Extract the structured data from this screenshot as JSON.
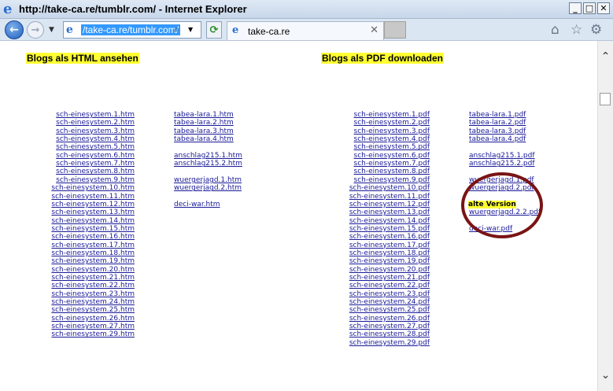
{
  "window": {
    "title": "http://take-ca.re/tumblr.com/ - Internet Explorer"
  },
  "address": {
    "url": "/take-ca.re/tumblr.com/"
  },
  "tab": {
    "label": "take-ca.re"
  },
  "headings": {
    "html": "Blogs als HTML ansehen",
    "pdf": "Blogs als PDF downloaden"
  },
  "html_col1": [
    "sch-einesystem.1.htm",
    "sch-einesystem.2.htm",
    "sch-einesystem.3.htm",
    "sch-einesystem.4.htm",
    "sch-einesystem.5.htm",
    "sch-einesystem.6.htm",
    "sch-einesystem.7.htm",
    "sch-einesystem.8.htm",
    "sch-einesystem.9.htm",
    "sch-einesystem.10.htm",
    "sch-einesystem.11.htm",
    "sch-einesystem.12.htm",
    "sch-einesystem.13.htm",
    "sch-einesystem.14.htm",
    "sch-einesystem.15.htm",
    "sch-einesystem.16.htm",
    "sch-einesystem.17.htm",
    "sch-einesystem.18.htm",
    "sch-einesystem.19.htm",
    "sch-einesystem.20.htm",
    "sch-einesystem.21.htm",
    "sch-einesystem.22.htm",
    "sch-einesystem.23.htm",
    "sch-einesystem.24.htm",
    "sch-einesystem.25.htm",
    "sch-einesystem.26.htm",
    "sch-einesystem.27.htm",
    "sch-einesystem.29.htm"
  ],
  "html_col2": {
    "tabea": [
      "tabea-lara.1.htm",
      "tabea-lara.2.htm",
      "tabea-lara.3.htm",
      "tabea-lara.4.htm"
    ],
    "anschlag": [
      "anschlag215.1.htm",
      "anschlag215.2.htm"
    ],
    "wuerger": [
      "wuergerjagd.1.htm",
      "wuergerjagd.2.htm"
    ],
    "deci": [
      "deci-war.htm"
    ]
  },
  "pdf_col1": [
    "sch-einesystem.1.pdf",
    "sch-einesystem.2.pdf",
    "sch-einesystem.3.pdf",
    "sch-einesystem.4.pdf",
    "sch-einesystem.5.pdf",
    "sch-einesystem.6.pdf",
    "sch-einesystem.7.pdf",
    "sch-einesystem.8.pdf",
    "sch-einesystem.9.pdf",
    "sch-einesystem.10.pdf",
    "sch-einesystem.11.pdf",
    "sch-einesystem.12.pdf",
    "sch-einesystem.13.pdf",
    "sch-einesystem.14.pdf",
    "sch-einesystem.15.pdf",
    "sch-einesystem.16.pdf",
    "sch-einesystem.17.pdf",
    "sch-einesystem.18.pdf",
    "sch-einesystem.19.pdf",
    "sch-einesystem.20.pdf",
    "sch-einesystem.21.pdf",
    "sch-einesystem.22.pdf",
    "sch-einesystem.23.pdf",
    "sch-einesystem.24.pdf",
    "sch-einesystem.25.pdf",
    "sch-einesystem.26.pdf",
    "sch-einesystem.27.pdf",
    "sch-einesystem.28.pdf",
    "sch-einesystem.29.pdf"
  ],
  "pdf_col2": {
    "tabea": [
      "tabea-lara.1.pdf",
      "tabea-lara.2.pdf",
      "tabea-lara.3.pdf",
      "tabea-lara.4.pdf"
    ],
    "anschlag": [
      "anschlag215.1.pdf",
      "anschlag215.2.pdf"
    ],
    "wuerger": [
      "wuergerjagd.1.pdf",
      "wuergerjagd.2.pdf"
    ],
    "alte_label": "alte Version",
    "alte_link": "wuergerjagd.2.2.pdf",
    "deci": "deci-war.pdf"
  },
  "colors": {
    "highlight": "#ffff33",
    "link": "#1a1a99",
    "annotation_circle": "#7a1414"
  }
}
